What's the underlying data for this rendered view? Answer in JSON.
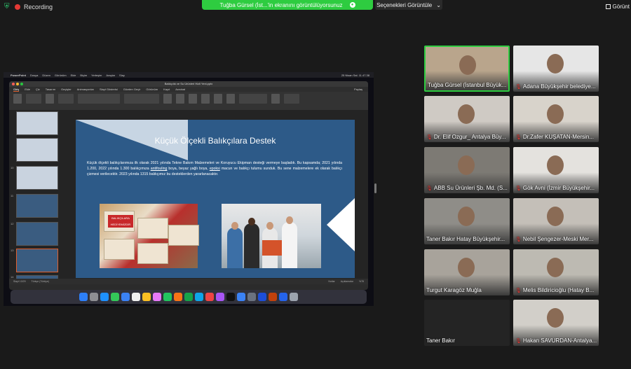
{
  "topbar": {
    "recording_label": "Recording",
    "share_text": "Tuğba Gürsel (İst...'in ekranını görüntülüyorsunuz",
    "options_label": "Seçenekleri Görüntüle",
    "view_label": "Görünt"
  },
  "mac": {
    "app": "PowerPoint",
    "menus": [
      "Dosya",
      "Düzen",
      "Görünüm",
      "Ekle",
      "Biçim",
      "Yerleşim",
      "Araçlar",
      "Slay"
    ],
    "clock": "25 Nisan Sal. 11.47.38"
  },
  "ppt": {
    "window_title": "Balıkçılık ve Su Ürünleri Hizli Yeni.pptx",
    "ribbon_tabs": [
      "Giriş",
      "Ekle",
      "Çiz",
      "Tasarım",
      "Geçişler",
      "Animasyonlar",
      "Slayt Gösterisi",
      "Gözden Geçir",
      "Görünüm",
      "Kayıt",
      "Acrobat"
    ],
    "share_button": "Paylaş",
    "thumb_numbers": [
      "",
      "",
      "",
      "10",
      "11",
      "12",
      "13",
      "14"
    ],
    "status_left": "Slayt 13/29",
    "status_lang": "Türkçe (Türkiye)",
    "status_notes": "Notlar",
    "status_comments": "Açıklamalar",
    "zoom": "%78"
  },
  "slide": {
    "title": "Küçük Ölçekli Balıkçılara Destek",
    "body_part1": "Küçük ölçekli balıkçılarımıza ilk olarak 2021 yılında Tekne Bakım Malzemeleri ve Koruyucu Ekipman desteği vermeye başladık. Bu kapsamda; 2021 yılında 1.200, 2022 yılında 1.300 balıkçımıza ",
    "body_underline1": "antifouling",
    "body_part2": " boya, beyaz yağlı boya, ",
    "body_underline2": "epoksi",
    "body_part3": " macun ve balıkçı tulumu sunduk. Bu sene malzemelere ek olarak balıkçı çizmesi verilecektir. 2023 yılında 1315 balıkçımız bu desteklerden yararlanacaktır.",
    "box_label": "BALIKÇILARA HEDİYEMİZDİR"
  },
  "participants": [
    {
      "name": "Tuğba Gürsel (İstanbul Büyük...",
      "muted": false,
      "speaker": true,
      "video": true,
      "bg": "#b9a58c"
    },
    {
      "name": "Adana Büyükşehir belediye...",
      "muted": true,
      "speaker": false,
      "video": true,
      "bg": "#e6e6e6"
    },
    {
      "name": "Dr. Elif Ozgur_ Antalya Büy...",
      "muted": true,
      "speaker": false,
      "video": true,
      "bg": "#cfcac4"
    },
    {
      "name": "Dr.Zafer KUŞATAN-Mersin...",
      "muted": true,
      "speaker": false,
      "video": true,
      "bg": "#d8d3cb"
    },
    {
      "name": "ABB Su Ürünleri Şb. Md. (S...",
      "muted": true,
      "speaker": false,
      "video": true,
      "bg": "#7d7a74"
    },
    {
      "name": "Gök Avni (İzmir Büyükşehir...",
      "muted": true,
      "speaker": false,
      "video": true,
      "bg": "#e4e2de"
    },
    {
      "name": "Taner Bakır Hatay Büyükşehir...",
      "muted": false,
      "speaker": false,
      "video": true,
      "bg": "#8f8d88"
    },
    {
      "name": "Nebil Şengezer-Meski Mer...",
      "muted": true,
      "speaker": false,
      "video": true,
      "bg": "#c4bfb8"
    },
    {
      "name": "Turgut Karagöz Muğla",
      "muted": false,
      "speaker": false,
      "video": true,
      "bg": "#a8a39b"
    },
    {
      "name": "Melis Bildiricioğlu (Hatay B...",
      "muted": true,
      "speaker": false,
      "video": true,
      "bg": "#bdbab2"
    },
    {
      "name": "Taner Bakır",
      "muted": false,
      "speaker": false,
      "video": false,
      "bg": "#242424"
    },
    {
      "name": "Hakan SAVURDAN-Antalya...",
      "muted": true,
      "speaker": false,
      "video": true,
      "bg": "#d2cfc9"
    }
  ]
}
